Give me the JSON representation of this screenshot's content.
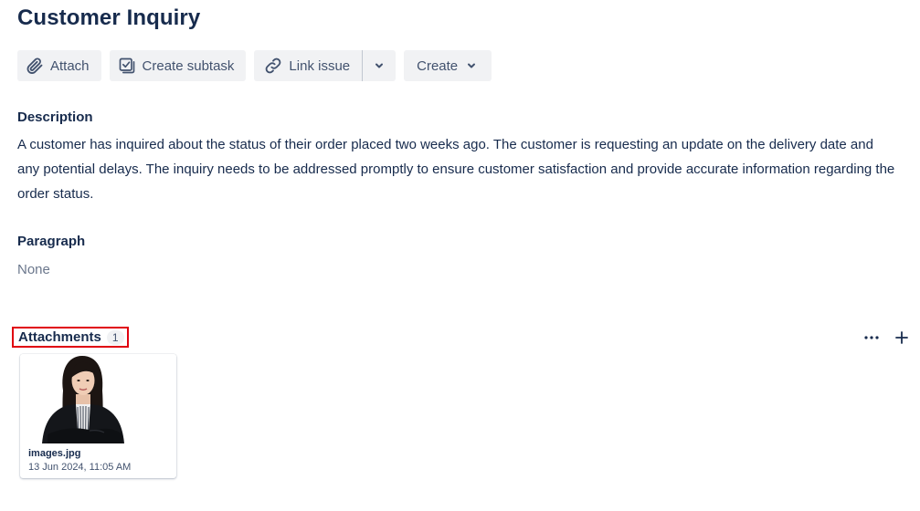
{
  "issue": {
    "title": "Customer Inquiry"
  },
  "toolbar": {
    "attach_label": "Attach",
    "create_subtask_label": "Create subtask",
    "link_issue_label": "Link issue",
    "create_label": "Create"
  },
  "description": {
    "label": "Description",
    "text": "A customer has inquired about the status of their order placed two weeks ago. The customer is requesting an update on the delivery date and any potential delays. The inquiry needs to be addressed promptly to ensure customer satisfaction and provide accurate information regarding the order status."
  },
  "paragraph": {
    "label": "Paragraph",
    "value": "None"
  },
  "attachments": {
    "label": "Attachments",
    "count": "1",
    "files": [
      {
        "name": "images.jpg",
        "date": "13 Jun 2024, 11:05 AM",
        "thumbnail": "woman-portrait-photo"
      }
    ]
  },
  "icons": {
    "attach": "paperclip-icon",
    "subtask": "subtask-icon",
    "link": "link-icon",
    "more": "more-icon",
    "add": "plus-icon"
  },
  "colors": {
    "highlight_border": "#e0000f",
    "button_bg": "#f1f2f4",
    "text_primary": "#172b4d",
    "text_secondary": "#42526e"
  }
}
